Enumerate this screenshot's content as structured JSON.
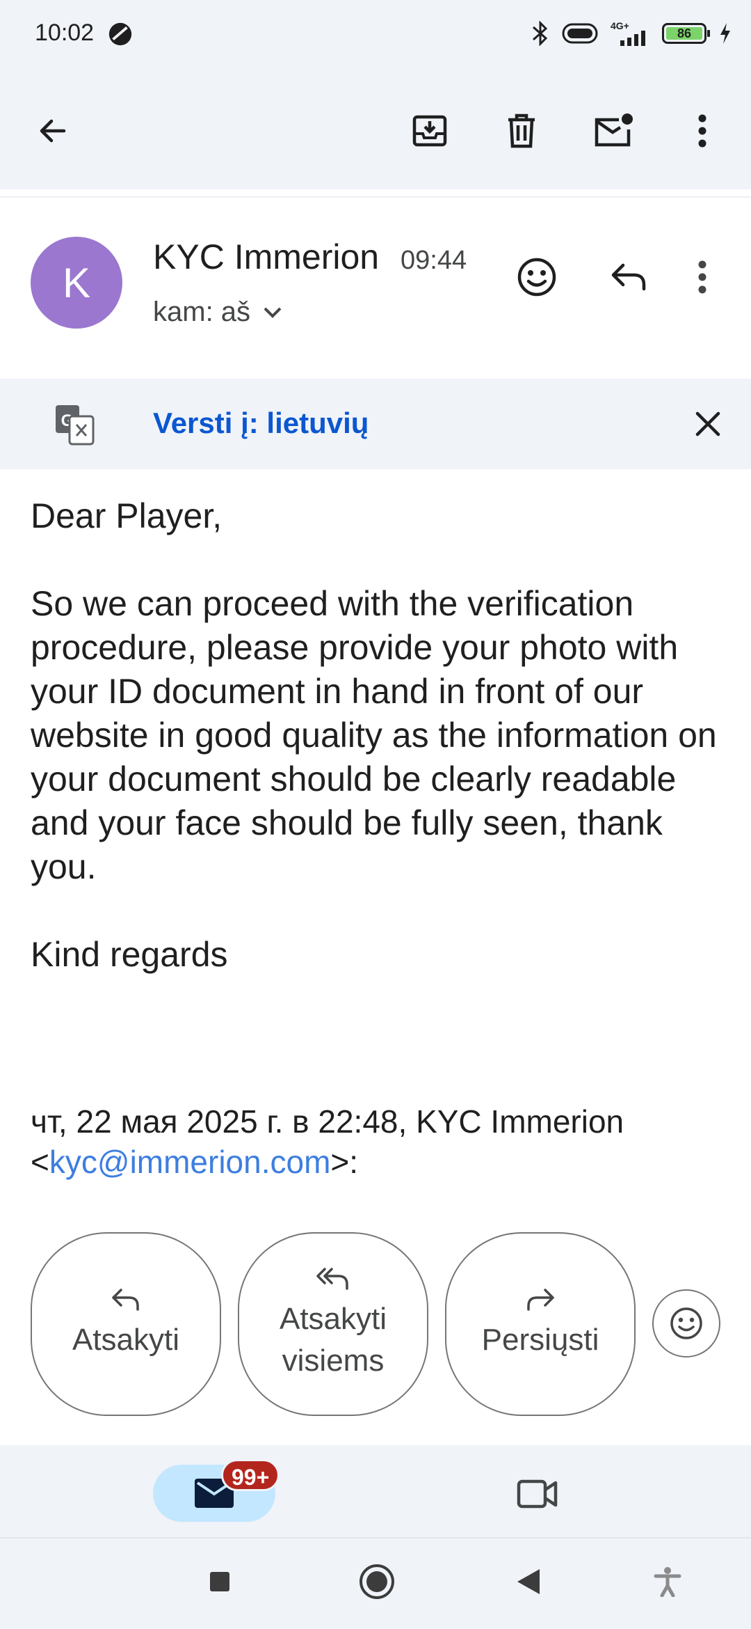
{
  "status_bar": {
    "time": "10:02",
    "network_label": "4G+",
    "battery_level": "86"
  },
  "top_bar": {
    "back_icon": "arrow-left-icon",
    "archive_icon": "archive-icon",
    "delete_icon": "trash-icon",
    "mark_unread_icon": "mail-unread-icon",
    "more_icon": "more-vert-icon"
  },
  "message_header": {
    "avatar_letter": "K",
    "avatar_color": "#9b77d0",
    "sender_name": "KYC Immerion",
    "time": "09:44",
    "recipient": "kam: aš"
  },
  "translate_bar": {
    "link": "Versti į: lietuvių"
  },
  "body": {
    "greeting": "Dear Player,",
    "paragraph": "So we can proceed with the verification procedure, please provide your photo with your ID document in hand in front of our website in good quality as the information on your document should be clearly readable and your face should be fully seen, thank you.",
    "closing": "Kind regards"
  },
  "quoted": {
    "header_prefix": "чт, 22 мая 2025 г. в 22:48, KYC Immerion",
    "lt": "<",
    "email": "kyc@immerion.com",
    "suffix": ">:"
  },
  "actions": {
    "reply_line": "Atsakyti",
    "reply_all_line1": "Atsakyti",
    "reply_all_line2": "visiems",
    "forward_line": "Persiųsti"
  },
  "bottom_nav": {
    "mail_badge": "99+"
  },
  "colors": {
    "surface": "#f0f3f8",
    "accent_link": "#0b57d0",
    "badge": "#b3261e",
    "active_pill": "#c2e7ff"
  }
}
